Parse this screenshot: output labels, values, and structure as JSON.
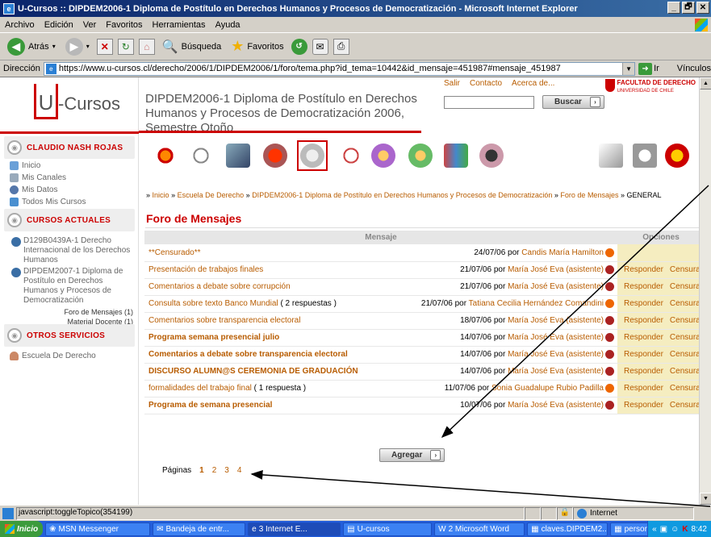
{
  "window": {
    "title": "U-Cursos :: DIPDEM2006-1 Diploma de Postítulo en Derechos Humanos y Procesos de Democratización - Microsoft Internet Explorer",
    "controls": [
      "_",
      "🗗",
      "✕"
    ]
  },
  "menu": [
    "Archivo",
    "Edición",
    "Ver",
    "Favoritos",
    "Herramientas",
    "Ayuda"
  ],
  "toolbar": {
    "back": "Atrás",
    "search": "Búsqueda",
    "favorites": "Favoritos"
  },
  "address": {
    "label": "Dirección",
    "url": "https://www.u-cursos.cl/derecho/2006/1/DIPDEM2006/1/foro/tema.php?id_tema=10442&id_mensaje=451987#mensaje_451987",
    "go": "Ir",
    "links": "Vínculos"
  },
  "site": {
    "logo_u": "U",
    "logo_text": "-Cursos",
    "course_title": "DIPDEM2006-1 Diploma de Postítulo en Derechos Humanos y Procesos de Democratización 2006, Semestre Otoño",
    "top_links": [
      "Salir",
      "Contacto",
      "Acerca de..."
    ],
    "search_button": "Buscar",
    "faculty": "FACULTAD DE DERECHO",
    "faculty_sub": "UNIVERSIDAD DE CHILE"
  },
  "sidebar": {
    "user": "CLAUDIO NASH ROJAS",
    "nav": [
      "Inicio",
      "Mis Canales",
      "Mis Datos",
      "Todos Mis Cursos"
    ],
    "current_header": "CURSOS ACTUALES",
    "courses": [
      "D129B0439A-1 Derecho Internacional de los Derechos Humanos",
      "DIPDEM2007-1 Diploma de Postítulo en Derechos Humanos y Procesos de Democratización"
    ],
    "subnav": [
      "Foro de Mensajes (1)",
      "Material Docente (1)"
    ],
    "other_header": "OTROS SERVICIOS",
    "other": [
      "Escuela De Derecho"
    ]
  },
  "breadcrumb": {
    "sep": "»",
    "items": [
      "Inicio",
      "Escuela De Derecho",
      "DIPDEM2006-1 Diploma de Postítulo en Derechos Humanos y Procesos de Democratización",
      "Foro de Mensajes"
    ],
    "current": "GENERAL"
  },
  "forum": {
    "title": "Foro de Mensajes",
    "col_message": "Mensaje",
    "col_options": "Opciones",
    "by": "por",
    "reply": "Responder",
    "censor": "Censurar",
    "rows": [
      {
        "subject": "**Censurado**",
        "extra": "",
        "date": "24/07/06",
        "author": "Candis María Hamilton",
        "bold": false,
        "options": false
      },
      {
        "subject": "Presentación de trabajos finales",
        "extra": "",
        "date": "21/07/06",
        "author": "María José Eva (asistente)",
        "bold": false,
        "options": true
      },
      {
        "subject": "Comentarios a debate sobre corrupción",
        "extra": "",
        "date": "21/07/06",
        "author": "María José Eva (asistente)",
        "bold": false,
        "options": true
      },
      {
        "subject": "Consulta sobre texto Banco Mundial",
        "extra": "( 2 respuestas )",
        "date": "21/07/06",
        "author": "Tatiana Cecilia Hernández Comandini",
        "bold": false,
        "options": true
      },
      {
        "subject": "Comentarios sobre transparencia electoral",
        "extra": "",
        "date": "18/07/06",
        "author": "María José Eva (asistente)",
        "bold": false,
        "options": true
      },
      {
        "subject": "Programa semana presencial julio",
        "extra": "",
        "date": "14/07/06",
        "author": "María José Eva (asistente)",
        "bold": true,
        "options": true
      },
      {
        "subject": "Comentarios a debate sobre transparencia electoral",
        "extra": "",
        "date": "14/07/06",
        "author": "María José Eva (asistente)",
        "bold": true,
        "options": true
      },
      {
        "subject": "DISCURSO ALUMN@S CEREMONIA DE GRADUACIÓN",
        "extra": "",
        "date": "14/07/06",
        "author": "María José Eva (asistente)",
        "bold": true,
        "options": true
      },
      {
        "subject": "formalidades del trabajo final",
        "extra": "( 1 respuesta )",
        "date": "11/07/06",
        "author": "Sonia Guadalupe Rubio Padilla",
        "bold": false,
        "options": true
      },
      {
        "subject": "Programa de semana presencial",
        "extra": "",
        "date": "10/07/06",
        "author": "María José Eva (asistente)",
        "bold": true,
        "options": true
      }
    ],
    "add_button": "Agregar",
    "pages_label": "Páginas",
    "pages": [
      "1",
      "2",
      "3",
      "4"
    ]
  },
  "status": {
    "text": "javascript:toggleTopico(354199)",
    "zone": "Internet"
  },
  "taskbar": {
    "start": "Inicio",
    "tasks": [
      "MSN Messenger",
      "Bandeja de entr...",
      "3 Internet E...",
      "U-cursos",
      "2 Microsoft Word",
      "claves.DIPDEM2...",
      "personas_DIPD..."
    ],
    "clock": "8:42"
  },
  "colors": {
    "accent": "#cc0000",
    "link": "#b85c00",
    "options_bg": "#f5edc0"
  }
}
